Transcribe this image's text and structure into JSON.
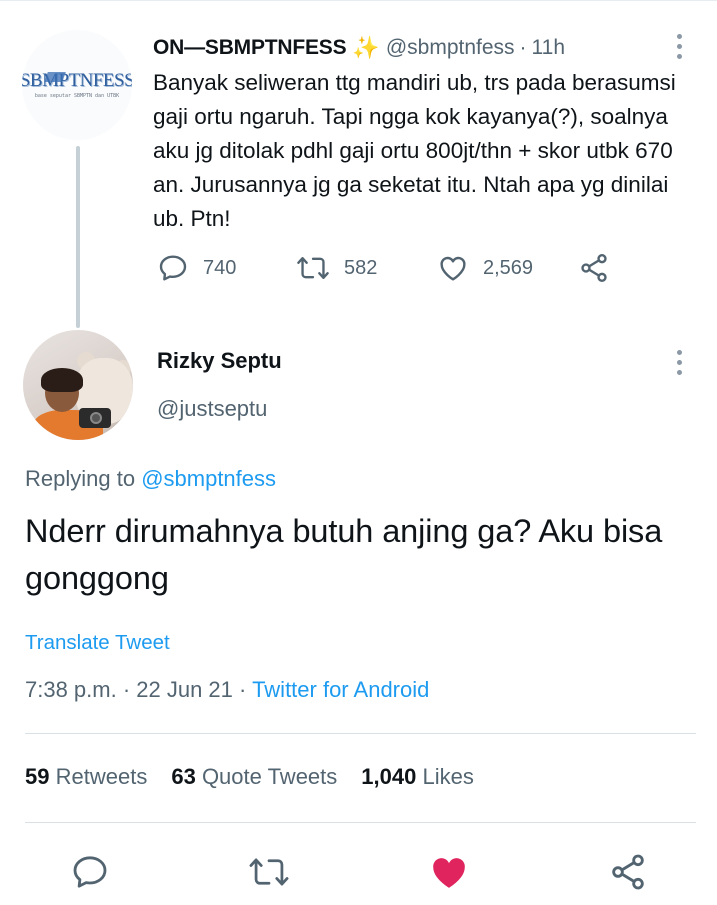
{
  "parent_tweet": {
    "avatar": {
      "logo_text": "SBMPTNFESS",
      "logo_subtext": "base seputar SBMPTN dan UTBK"
    },
    "display_name": "ON—SBMPTNFESS",
    "badge_icon": "sparkles-icon",
    "handle": "@sbmptnfess",
    "separator": "·",
    "time": "11h",
    "text": "Banyak seliweran ttg mandiri ub, trs pada berasumsi gaji ortu ngaruh. Tapi ngga kok kayanya(?), soalnya aku jg ditolak pdhl gaji ortu 800jt/thn + skor utbk 670 an. Jurusannya jg ga seketat itu. Ntah apa yg dinilai ub. Ptn!",
    "actions": {
      "reply_count": "740",
      "retweet_count": "582",
      "like_count": "2,569"
    }
  },
  "main_tweet": {
    "display_name": "Rizky Septu",
    "handle": "@justseptu",
    "replying_prefix": "Replying to ",
    "replying_to": "@sbmptnfess",
    "text": "Nderr dirumahnya butuh anjing ga? Aku bisa gonggong",
    "translate_label": "Translate Tweet",
    "timestamp": "7:38 p.m. · 22 Jun 21 · ",
    "source": "Twitter for Android"
  },
  "stats": [
    {
      "count": "59",
      "label": "Retweets"
    },
    {
      "count": "63",
      "label": "Quote Tweets"
    },
    {
      "count": "1,040",
      "label": "Likes"
    }
  ],
  "colors": {
    "accent": "#1d9bf0",
    "secondary_text": "#536471",
    "like_active": "#e0245e",
    "sparkle": "#ffcc33"
  }
}
